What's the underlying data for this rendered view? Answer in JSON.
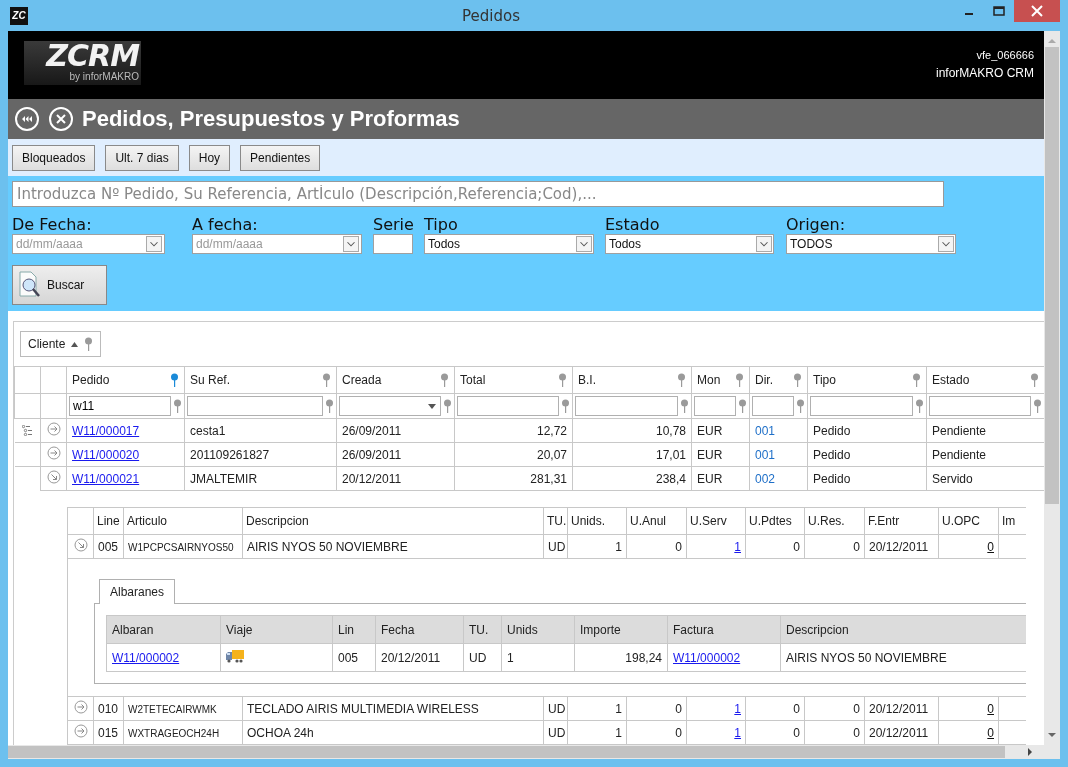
{
  "window": {
    "title": "Pedidos",
    "app_icon_text": "ZC"
  },
  "header": {
    "logo_text": "ZCRM",
    "logo_byline": "by inforMAKRO",
    "user": "vfe_066666",
    "app_name": "inforMAKRO CRM"
  },
  "page_title": "Pedidos, Presupuestos y Proformas",
  "quick_filters": [
    "Bloqueados",
    "Ult. 7 dias",
    "Hoy",
    "Pendientes"
  ],
  "search": {
    "placeholder": "Introduzca Nº Pedido, Su Referencia, ArtÍculo (Descripción,Referencia;Cod),..."
  },
  "filters": [
    {
      "label": "De Fecha:",
      "kind": "date",
      "placeholder": "dd/mm/aaaa"
    },
    {
      "label": "A fecha:",
      "kind": "date",
      "placeholder": "dd/mm/aaaa"
    },
    {
      "label": "Serie",
      "kind": "text"
    },
    {
      "label": "Tipo",
      "kind": "select",
      "value": "Todos"
    },
    {
      "label": "Estado",
      "kind": "select",
      "value": "Todos"
    },
    {
      "label": "Origen:",
      "kind": "select",
      "value": "TODOS"
    }
  ],
  "search_button": "Buscar",
  "grid": {
    "group_by": "Cliente",
    "columns": [
      {
        "label": "Pedido",
        "kind": "link",
        "filtered": true,
        "filter": {
          "kind": "text",
          "value": "w11"
        }
      },
      {
        "label": "Su Ref.",
        "kind": "text",
        "filtered": false,
        "filter": {
          "kind": "text"
        }
      },
      {
        "label": "Creada",
        "kind": "text",
        "filtered": false,
        "filter": {
          "kind": "select"
        }
      },
      {
        "label": "Total",
        "kind": "number",
        "filtered": false,
        "filter": {
          "kind": "text"
        }
      },
      {
        "label": "B.I.",
        "kind": "number",
        "filtered": false,
        "filter": {
          "kind": "text"
        }
      },
      {
        "label": "Mon",
        "kind": "text",
        "filtered": false,
        "filter": {
          "kind": "text"
        }
      },
      {
        "label": "Dir.",
        "kind": "code",
        "filtered": false,
        "filter": {
          "kind": "text"
        }
      },
      {
        "label": "Tipo",
        "kind": "text",
        "filtered": false,
        "filter": {
          "kind": "text"
        }
      },
      {
        "label": "Estado",
        "kind": "text",
        "filtered": false,
        "filter": {
          "kind": "text"
        }
      }
    ],
    "rows": [
      {
        "current": true,
        "expanded": false,
        "cells": [
          "W11/000017",
          "cesta1",
          "26/09/2011",
          "12,72",
          "10,78",
          "EUR",
          "001",
          "Pedido",
          "Pendiente"
        ]
      },
      {
        "current": false,
        "expanded": false,
        "cells": [
          "W11/000020",
          "201109261827",
          "26/09/2011",
          "20,07",
          "17,01",
          "EUR",
          "001",
          "Pedido",
          "Pendiente"
        ]
      },
      {
        "current": false,
        "expanded": true,
        "cells": [
          "W11/000021",
          "JMALTEMIR",
          "20/12/2011",
          "281,31",
          "238,4",
          "EUR",
          "002",
          "Pedido",
          "Servido"
        ]
      }
    ]
  },
  "lines": {
    "columns": [
      {
        "label": "Line",
        "kind": "text"
      },
      {
        "label": "Articulo",
        "kind": "code"
      },
      {
        "label": "Descripcion",
        "kind": "text"
      },
      {
        "label": "TU.",
        "kind": "text"
      },
      {
        "label": "Unids.",
        "kind": "number"
      },
      {
        "label": "U.Anul",
        "kind": "number"
      },
      {
        "label": "U.Serv",
        "kind": "link"
      },
      {
        "label": "U.Pdtes",
        "kind": "number"
      },
      {
        "label": "U.Res.",
        "kind": "number"
      },
      {
        "label": "F.Entr",
        "kind": "text"
      },
      {
        "label": "U.OPC",
        "kind": "underlined"
      },
      {
        "label": "Im",
        "kind": "number"
      }
    ],
    "rows": [
      {
        "expanded": true,
        "cells": [
          "005",
          "W1PCPCSAIRNYOS50",
          "AIRIS NYOS 50 NOVIEMBRE",
          "UD",
          "1",
          "0",
          "1",
          "0",
          "0",
          "20/12/2011",
          "0",
          null
        ],
        "detail": {
          "tab": "Albaranes",
          "columns": [
            {
              "label": "Albaran",
              "kind": "link"
            },
            {
              "label": "Viaje",
              "kind": "icon"
            },
            {
              "label": "Lin",
              "kind": "text"
            },
            {
              "label": "Fecha",
              "kind": "text"
            },
            {
              "label": "TU.",
              "kind": "text"
            },
            {
              "label": "Unids",
              "kind": "text"
            },
            {
              "label": "Importe",
              "kind": "number"
            },
            {
              "label": "Factura",
              "kind": "link"
            },
            {
              "label": "Descripcion",
              "kind": "text"
            }
          ],
          "rows": [
            {
              "cells": [
                "W11/000002",
                null,
                "005",
                "20/12/2011",
                "UD",
                "1",
                "198,24",
                "W11/000002",
                "AIRIS NYOS 50 NOVIEMBRE"
              ]
            }
          ]
        }
      },
      {
        "expanded": false,
        "cells": [
          "010",
          "W2TETECAIRWMK",
          "TECLADO AIRIS MULTIMEDIA WIRELESS",
          "UD",
          "1",
          "0",
          "1",
          "0",
          "0",
          "20/12/2011",
          "0",
          null
        ]
      },
      {
        "expanded": false,
        "cells": [
          "015",
          "WXTRAGEOCH24H",
          "OCHOA 24h",
          "UD",
          "1",
          "0",
          "1",
          "0",
          "0",
          "20/12/2011",
          "0",
          null
        ]
      }
    ]
  }
}
